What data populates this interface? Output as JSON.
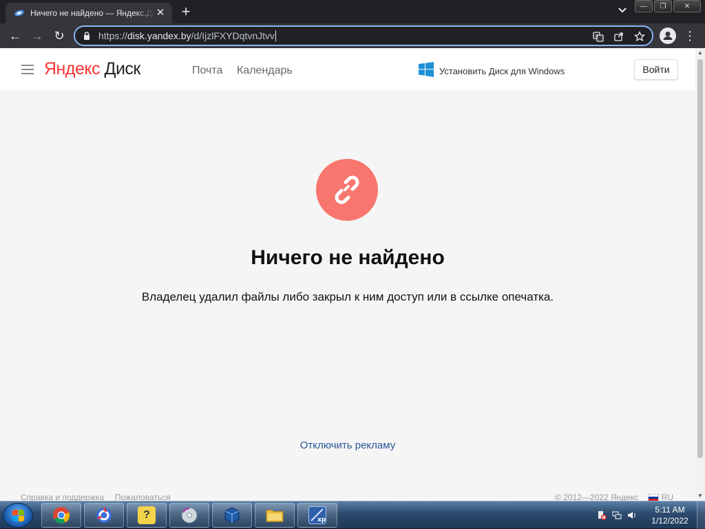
{
  "browser": {
    "tab_title": "Ничего не найдено — Яндекс.Диск",
    "tab_close": "✕",
    "new_tab": "+",
    "tab_search": "⌄",
    "url_prefix": "https://",
    "url_host": "disk.yandex.by",
    "url_path": "/d/IjzlFXYDqtvnJtvv",
    "window_buttons": {
      "minimize": "—",
      "maximize": "❐",
      "close": "✕"
    },
    "nav": {
      "back": "←",
      "forward": "→",
      "reload": "↻"
    },
    "menu": "⋮"
  },
  "header": {
    "logo_ya": "Яндекс",
    "logo_disk": "Диск",
    "nav_links": [
      "Почта",
      "Календарь"
    ],
    "install_label": "Установить Диск для Windows",
    "login_label": "Войти"
  },
  "main": {
    "title": "Ничего не найдено",
    "subtitle": "Владелец удалил файлы либо закрыл к ним доступ или в ссылке опечатка.",
    "ads_link": "Отключить рекламу"
  },
  "footer": {
    "help": "Справка и поддержка",
    "complain": "Пожаловаться",
    "copyright": "© 2012—2022 Яндекс",
    "lang": "RU"
  },
  "taskbar": {
    "clock_time": "5:11 AM",
    "clock_date": "1/12/2022"
  },
  "colors": {
    "accent": "#8ab4f8",
    "brand_red": "#ff3333",
    "broken_link_circle": "#f8766d",
    "link_blue": "#2b5797"
  },
  "icons": [
    "yandex-disk-favicon",
    "lock-icon",
    "translate-icon",
    "share-icon",
    "star-icon",
    "profile-icon",
    "hamburger-icon",
    "windows-logo-icon",
    "broken-link-icon",
    "chrome-icon",
    "ccleaner-icon",
    "help-icon",
    "disc-icon",
    "virtualbox-icon",
    "folder-icon",
    "xp-mode-icon"
  ]
}
